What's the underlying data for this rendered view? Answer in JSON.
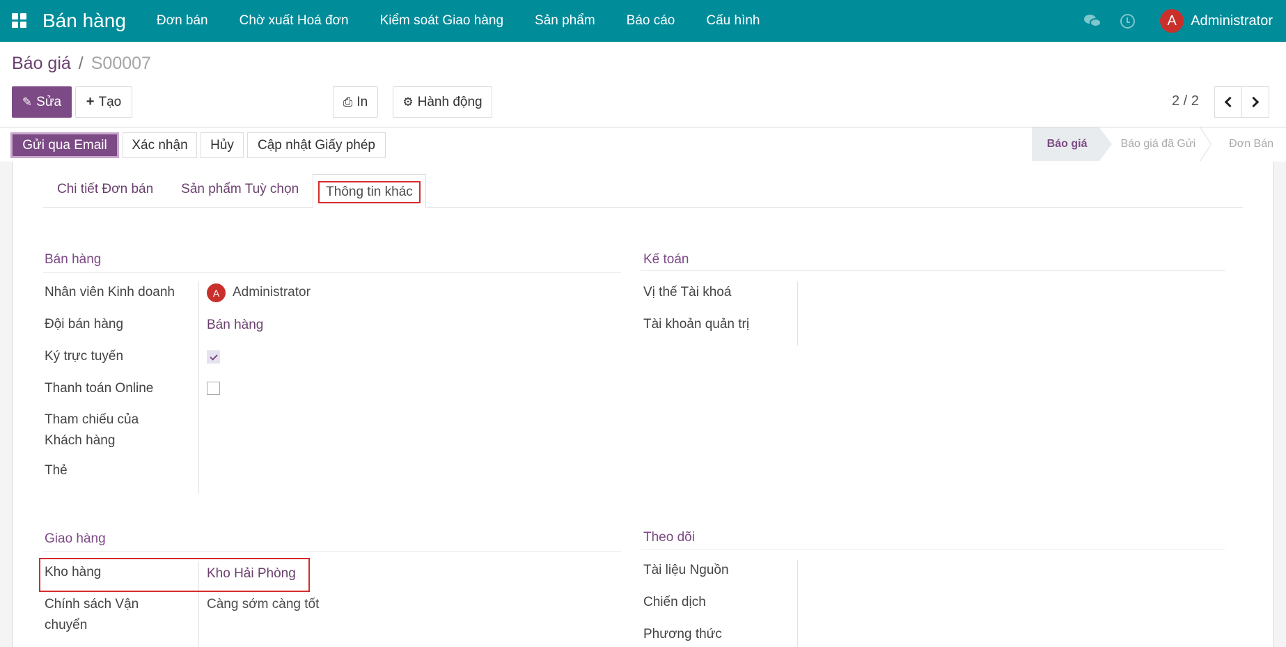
{
  "navbar": {
    "app_name": "Bán hàng",
    "menu": [
      "Đơn bán",
      "Chờ xuất Hoá đơn",
      "Kiểm soát Giao hàng",
      "Sản phẩm",
      "Báo cáo",
      "Cấu hình"
    ],
    "icons": {
      "apps": "apps-grid-icon",
      "chat": "chat-icon",
      "activity": "clock-icon"
    },
    "user": {
      "initial": "A",
      "name": "Administrator"
    },
    "color": "#018c9a"
  },
  "breadcrumb": {
    "parent": "Báo giá",
    "separator": "/",
    "current": "S00007"
  },
  "toolbar": {
    "edit_label": "Sửa",
    "create_label": "Tạo",
    "print_label": "In",
    "action_label": "Hành động",
    "pager": "2 / 2",
    "primary_color": "#7c4a85"
  },
  "statusbar": {
    "buttons": [
      "Gửi qua Email",
      "Xác nhận",
      "Hủy",
      "Cập nhật Giấy phép"
    ],
    "stages": [
      {
        "label": "Báo giá",
        "active": true
      },
      {
        "label": "Báo giá đã Gửi",
        "active": false
      },
      {
        "label": "Đơn Bán",
        "active": false
      }
    ]
  },
  "tabs": [
    {
      "label": "Chi tiết Đơn bán",
      "active": false
    },
    {
      "label": "Sản phẩm Tuỳ chọn",
      "active": false
    },
    {
      "label": "Thông tin khác",
      "active": true
    }
  ],
  "sections": {
    "sales": {
      "title": "Bán hàng",
      "fields": {
        "salesperson": {
          "label": "Nhân viên Kinh doanh",
          "value": "Administrator",
          "avatar_initial": "A"
        },
        "sales_team": {
          "label": "Đội bán hàng",
          "value": "Bán hàng"
        },
        "online_signature": {
          "label": "Ký trực tuyến",
          "checked": true
        },
        "online_payment": {
          "label": "Thanh toán Online",
          "checked": false
        },
        "customer_reference": {
          "label_line1": "Tham chiếu của",
          "label_line2": "Khách hàng",
          "value": ""
        },
        "tags": {
          "label": "Thẻ",
          "value": ""
        }
      }
    },
    "accounting": {
      "title": "Kế toán",
      "fields": {
        "fiscal_position": {
          "label": "Vị thế Tài khoá",
          "value": ""
        },
        "analytic_account": {
          "label": "Tài khoản quản trị",
          "value": ""
        }
      }
    },
    "delivery": {
      "title": "Giao hàng",
      "fields": {
        "warehouse": {
          "label": "Kho hàng",
          "value": "Kho Hải Phòng"
        },
        "shipping_policy": {
          "label_line1": "Chính sách Vận",
          "label_line2": "chuyển",
          "value": "Càng sớm càng tốt"
        }
      }
    },
    "tracking": {
      "title": "Theo dõi",
      "fields": {
        "source_document": {
          "label": "Tài liệu Nguồn",
          "value": ""
        },
        "campaign": {
          "label": "Chiến dịch",
          "value": ""
        },
        "medium": {
          "label": "Phương thức",
          "value": ""
        }
      }
    }
  }
}
